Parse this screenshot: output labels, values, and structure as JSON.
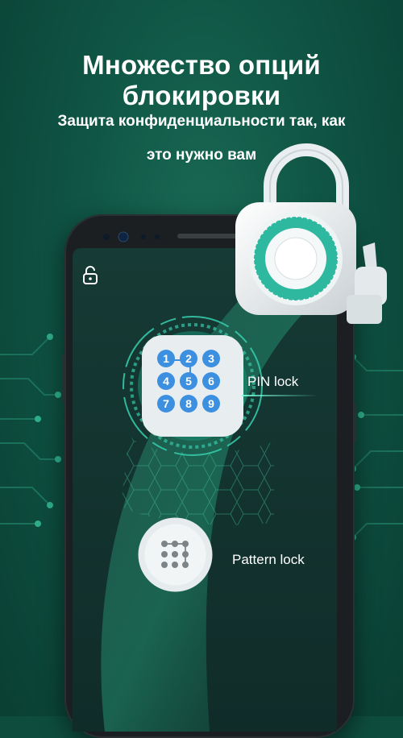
{
  "header": {
    "title": "Множество опций блокировки",
    "subtitle_line1": "Защита конфиденциальности так, как",
    "subtitle_line2": "это нужно вам"
  },
  "options": {
    "pin_label": "PIN lock",
    "pattern_label": "Pattern lock"
  },
  "keypad": {
    "digits": [
      "1",
      "2",
      "3",
      "4",
      "5",
      "6",
      "7",
      "8",
      "9"
    ]
  },
  "icons": {
    "padlock": "padlock-icon",
    "unlock": "unlock-icon",
    "keypad": "keypad-icon",
    "pattern": "pattern-icon"
  },
  "colors": {
    "background": "#0e4d3e",
    "accent_teal": "#35c8a8",
    "key_blue": "#3d8fe0",
    "text": "#ffffff"
  }
}
